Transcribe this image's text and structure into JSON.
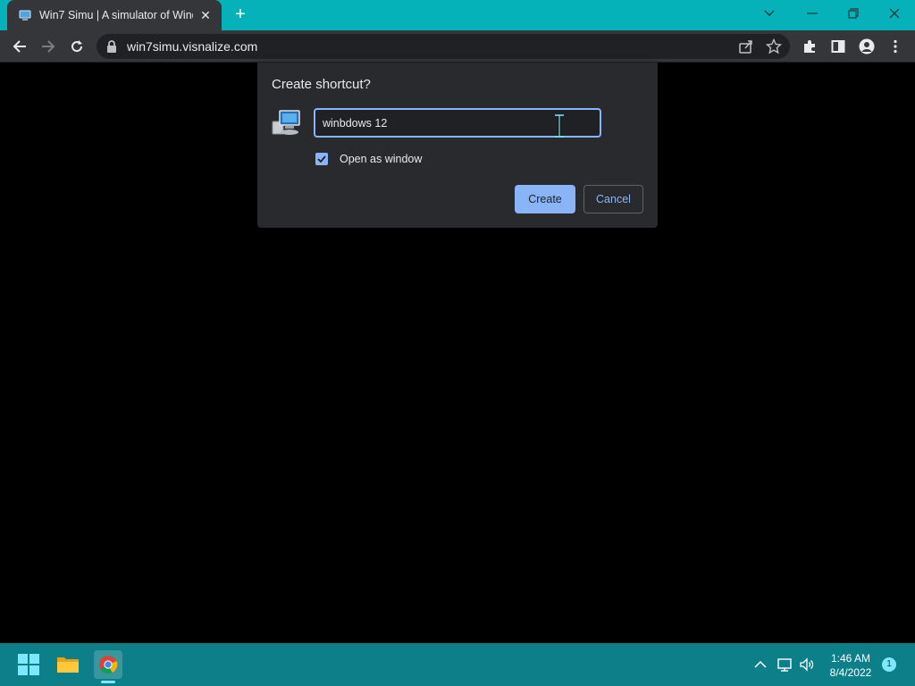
{
  "browser": {
    "tab_title": "Win7 Simu | A simulator of Wind",
    "tab_close": "✕",
    "new_tab": "+",
    "url": "win7simu.visnalize.com"
  },
  "dialog": {
    "title": "Create shortcut?",
    "name_value": "winbdows 12",
    "open_as_window_label": "Open as window",
    "open_as_window_checked": true,
    "create_label": "Create",
    "cancel_label": "Cancel"
  },
  "taskbar": {
    "time": "1:46 AM",
    "date": "8/4/2022",
    "notification_count": "1"
  },
  "colors": {
    "tabstrip": "#06b2b9",
    "taskbar": "#0d7f89",
    "accent": "#8ab4f8"
  }
}
